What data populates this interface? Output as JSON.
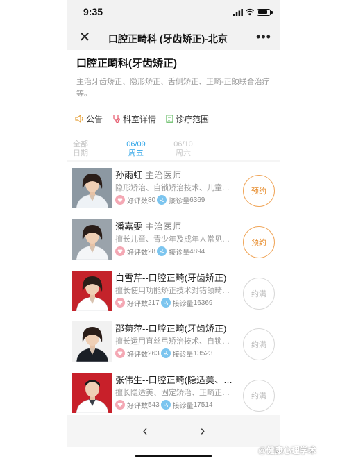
{
  "status_bar": {
    "time": "9:35"
  },
  "nav": {
    "title": "口腔正畸科 (牙齿矫正)-北京"
  },
  "department": {
    "name": "口腔正畸科(牙齿矫正)",
    "description": "主治牙齿矫正、隐形矫正、舌侧矫正、正畸-正颌联合治疗等。"
  },
  "links": [
    {
      "label": "公告",
      "icon": "speaker-icon"
    },
    {
      "label": "科室详情",
      "icon": "stethoscope-icon"
    },
    {
      "label": "诊疗范围",
      "icon": "document-icon"
    }
  ],
  "dates": {
    "all": {
      "line1": "全部",
      "line2": "日期"
    },
    "days": [
      {
        "date": "06/09",
        "weekday": "周五",
        "active": true
      },
      {
        "date": "06/10",
        "weekday": "周六",
        "active": false
      }
    ]
  },
  "doctors": [
    {
      "name": "孙雨虹",
      "title": "主治医师",
      "desc": "隐形矫治、自锁矫治技术、儿童早期矫治",
      "good_label": "好评数",
      "good": "80",
      "visits_label": "接诊量",
      "visits": "6369",
      "book": "预约",
      "bookable": true,
      "bg": "#8c98a2",
      "coat": "#eef2f6",
      "avatar": "female"
    },
    {
      "name": "潘嘉雯",
      "title": "主治医师",
      "desc": "擅长儿童、青少年及成年人常见错颌畸形",
      "good_label": "好评数",
      "good": "28",
      "visits_label": "接诊量",
      "visits": "4894",
      "book": "预约",
      "bookable": true,
      "bg": "#9aa3ab",
      "coat": "#f4f6f8",
      "avatar": "female"
    },
    {
      "name": "白雪芹--口腔正畸(牙齿矫正)",
      "title": "",
      "desc": "擅长使用功能矫正技术对错颌畸形进行矫治",
      "good_label": "好评数",
      "good": "217",
      "visits_label": "接诊量",
      "visits": "16369",
      "book": "约满",
      "bookable": false,
      "bg": "#c4232b",
      "coat": "#ffffff",
      "avatar": "female"
    },
    {
      "name": "邵菊萍--口腔正畸(牙齿矫正)",
      "title": "",
      "desc": "擅长运用直丝弓矫治技术、自锁托槽矫治",
      "good_label": "好评数",
      "good": "263",
      "visits_label": "接诊量",
      "visits": "13523",
      "book": "约满",
      "bookable": false,
      "bg": "#f1f1f1",
      "coat": "#1a1f26",
      "avatar": "female"
    },
    {
      "name": "张伟生--口腔正畸(隐适美、舌侧)",
      "title": "",
      "desc": "擅长隐适美、固定矫治、正畸正颌联合治疗",
      "good_label": "好评数",
      "good": "543",
      "visits_label": "接诊量",
      "visits": "17514",
      "book": "约满",
      "bookable": false,
      "bg": "#c8202a",
      "coat": "#ffffff",
      "avatar": "male"
    }
  ],
  "bottom": {
    "prev": "‹",
    "next": "›"
  },
  "watermark": "@健康心理学术"
}
